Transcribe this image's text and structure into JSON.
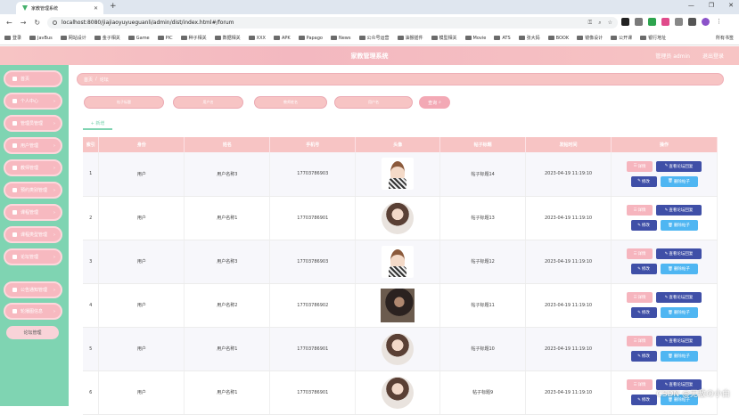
{
  "browser": {
    "tab_title": "家教管理系统",
    "url": "localhost:8080/jiajiaoyuyueguanli/admin/dist/index.html#/forum",
    "bookmarks": [
      "登录",
      "JavBus",
      "网站设计",
      "金子相关",
      "Game",
      "PIC",
      "种子相关",
      "数据相关",
      "XXX",
      "APK",
      "Papago",
      "News",
      "公众号运营",
      "油猴插件",
      "模型相关",
      "Movie",
      "ATS",
      "张大妈",
      "BOOK",
      "镜像设计",
      "公开课",
      "银行地址"
    ],
    "bookmarks_right": "所有书签"
  },
  "header": {
    "title": "家教管理系统",
    "user": "管理员 admin",
    "logout": "退出登录"
  },
  "sidebar": {
    "items": [
      {
        "label": "首页"
      },
      {
        "label": "个人中心"
      },
      {
        "label": "管理员管理"
      },
      {
        "label": "用户管理"
      },
      {
        "label": "教师管理"
      },
      {
        "label": "预约类别管理"
      },
      {
        "label": "课程管理"
      },
      {
        "label": "课程类型管理"
      },
      {
        "label": "论坛管理"
      },
      {
        "label": "公告通知管理"
      },
      {
        "label": "轮播图信息"
      }
    ],
    "sub_item": "论坛管理"
  },
  "breadcrumb": {
    "home": "首页",
    "sep": "/",
    "current": "论坛"
  },
  "filters": [
    {
      "placeholder": "帖子标题"
    },
    {
      "placeholder": "用户名"
    },
    {
      "placeholder": "教师姓名"
    },
    {
      "placeholder": "用户名"
    }
  ],
  "query_button": "查询",
  "add_button": "+ 新增",
  "table": {
    "headers": [
      "索引",
      "身份",
      "姓名",
      "手机号",
      "头像",
      "帖子标题",
      "发帖时间",
      "操作"
    ],
    "rows": [
      {
        "idx": "1",
        "role": "用户",
        "name": "用户名称3",
        "phone": "17703786903",
        "avatar": "cartoon",
        "title": "帖子标题14",
        "time": "2023-04-19 11:19:10"
      },
      {
        "idx": "2",
        "role": "用户",
        "name": "用户名称1",
        "phone": "17703786901",
        "avatar": "woman",
        "title": "帖子标题13",
        "time": "2023-04-19 11:19:10"
      },
      {
        "idx": "3",
        "role": "用户",
        "name": "用户名称3",
        "phone": "17703786903",
        "avatar": "cartoon",
        "title": "帖子标题12",
        "time": "2023-04-19 11:19:10"
      },
      {
        "idx": "4",
        "role": "用户",
        "name": "用户名称2",
        "phone": "17703786902",
        "avatar": "photo",
        "title": "帖子标题11",
        "time": "2023-04-19 11:19:10"
      },
      {
        "idx": "5",
        "role": "用户",
        "name": "用户名称1",
        "phone": "17703786901",
        "avatar": "woman",
        "title": "帖子标题10",
        "time": "2023-04-19 11:19:10"
      },
      {
        "idx": "6",
        "role": "用户",
        "name": "用户名称1",
        "phone": "17703786901",
        "avatar": "woman",
        "title": "帖子标题9",
        "time": "2023-04-19 11:19:10"
      }
    ],
    "actions": {
      "detail": "详情",
      "view": "查看论坛回复",
      "edit": "修改",
      "delete": "删除帖子"
    }
  },
  "watermark": "CSDN @无敌の小白",
  "colors": {
    "pink": "#f7c4c4",
    "mint": "#7fd4b2",
    "navy": "#3f4fa7",
    "sky": "#4fb6f2"
  }
}
